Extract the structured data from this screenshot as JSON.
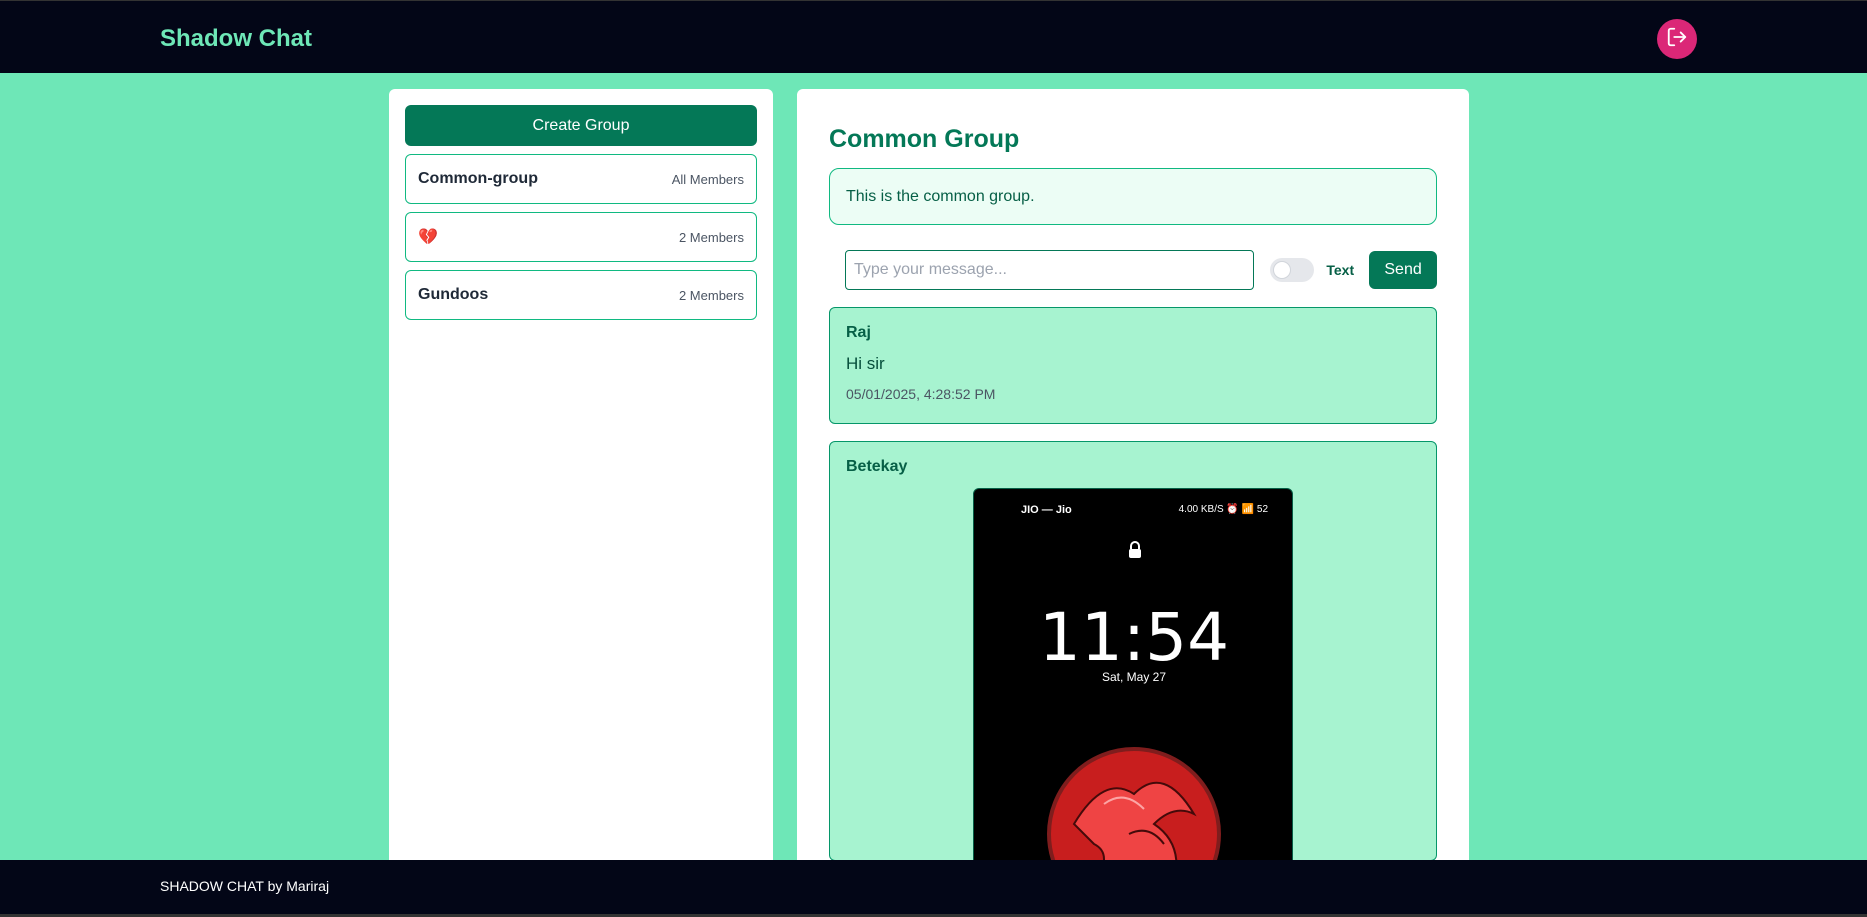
{
  "app": {
    "title": "Shadow Chat",
    "logout_icon": "logout-icon"
  },
  "sidebar": {
    "create_label": "Create Group",
    "groups": [
      {
        "name": "Common-group",
        "members": "All Members"
      },
      {
        "name": "💔",
        "members": "2 Members"
      },
      {
        "name": "Gundoos",
        "members": "2 Members"
      }
    ]
  },
  "chat": {
    "title": "Common Group",
    "description": "This is the common group.",
    "input_placeholder": "Type your message...",
    "toggle_label": "Text",
    "send_label": "Send",
    "messages": [
      {
        "sender": "Raj",
        "text": "Hi sir",
        "time": "05/01/2025, 4:28:52 PM"
      },
      {
        "sender": "Betekay",
        "image": {
          "carrier": "JIO — Jio",
          "status": "4.00 KB/S ⏰ 📶 52",
          "time": "11:54",
          "date": "Sat, May 27"
        }
      }
    ]
  },
  "footer": {
    "text": "SHADOW CHAT by Mariraj"
  },
  "colors": {
    "background": "#6ee7b7",
    "navbar": "#030617",
    "brand": "#6ee7b7",
    "primary": "#047857",
    "logout": "#db2777",
    "message_bg": "#a7f3d0"
  }
}
